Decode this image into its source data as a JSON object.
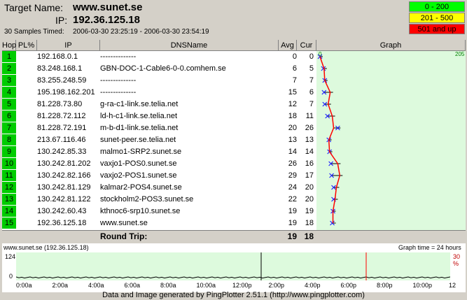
{
  "header": {
    "target_label": "Target Name:",
    "target_name": "www.sunet.se",
    "ip_label": "IP:",
    "ip": "192.36.125.18",
    "samples": "30 Samples Timed:",
    "time_range": "2006-03-30 23:25:19 - 2006-03-30 23:54:19"
  },
  "legend": [
    {
      "label": "0 - 200",
      "color": "#00ff00"
    },
    {
      "label": "201 - 500",
      "color": "#ffff00"
    },
    {
      "label": "501 and up",
      "color": "#ff0000"
    }
  ],
  "columns": {
    "hop": "Hop",
    "pl": "PL%",
    "ip": "IP",
    "dns": "DNSName",
    "avg": "Avg",
    "cur": "Cur",
    "graph": "Graph"
  },
  "graph_scale": {
    "min": "0",
    "max": "205"
  },
  "hops": [
    {
      "hop": "1",
      "ip": "192.168.0.1",
      "dns": "--------------",
      "avg": "0",
      "cur": "0"
    },
    {
      "hop": "2",
      "ip": "83.248.168.1",
      "dns": "GBN-DOC-1-Cable6-0-0.comhem.se",
      "avg": "6",
      "cur": "5"
    },
    {
      "hop": "3",
      "ip": "83.255.248.59",
      "dns": "--------------",
      "avg": "7",
      "cur": "7"
    },
    {
      "hop": "4",
      "ip": "195.198.162.201",
      "dns": "--------------",
      "avg": "15",
      "cur": "6"
    },
    {
      "hop": "5",
      "ip": "81.228.73.80",
      "dns": "g-ra-c1-link.se.telia.net",
      "avg": "12",
      "cur": "7"
    },
    {
      "hop": "6",
      "ip": "81.228.72.112",
      "dns": "ld-h-c1-link.se.telia.net",
      "avg": "18",
      "cur": "11"
    },
    {
      "hop": "7",
      "ip": "81.228.72.191",
      "dns": "m-b-d1-link.se.telia.net",
      "avg": "20",
      "cur": "26"
    },
    {
      "hop": "8",
      "ip": "213.67.116.46",
      "dns": "sunet-peer.se.telia.net",
      "avg": "13",
      "cur": "13"
    },
    {
      "hop": "9",
      "ip": "130.242.85.33",
      "dns": "malmo1-SRP2.sunet.se",
      "avg": "14",
      "cur": "14"
    },
    {
      "hop": "10",
      "ip": "130.242.81.202",
      "dns": "vaxjo1-POS0.sunet.se",
      "avg": "26",
      "cur": "16"
    },
    {
      "hop": "11",
      "ip": "130.242.82.166",
      "dns": "vaxjo2-POS1.sunet.se",
      "avg": "29",
      "cur": "17"
    },
    {
      "hop": "12",
      "ip": "130.242.81.129",
      "dns": "kalmar2-POS4.sunet.se",
      "avg": "24",
      "cur": "20"
    },
    {
      "hop": "13",
      "ip": "130.242.81.122",
      "dns": "stockholm2-POS3.sunet.se",
      "avg": "22",
      "cur": "20"
    },
    {
      "hop": "14",
      "ip": "130.242.60.43",
      "dns": "kthnoc6-srp10.sunet.se",
      "avg": "19",
      "cur": "19"
    },
    {
      "hop": "15",
      "ip": "192.36.125.18",
      "dns": "www.sunet.se",
      "avg": "19",
      "cur": "18"
    }
  ],
  "round_trip": {
    "label": "Round Trip:",
    "avg": "19",
    "cur": "18"
  },
  "history": {
    "title": "www.sunet.se (192.36.125.18)",
    "graph_time": "Graph time = 24 hours",
    "y_max": "124",
    "y_min": "0",
    "loss_label": "30 %",
    "ticks": [
      "0:00a",
      "2:00a",
      "4:00a",
      "6:00a",
      "8:00a",
      "10:00a",
      "12:00p",
      "2:00p",
      "4:00p",
      "6:00p",
      "8:00p",
      "10:00p",
      "12"
    ]
  },
  "footer": "Data and Image generated by PingPlotter 2.51.1 (http://www.pingplotter.com)"
}
